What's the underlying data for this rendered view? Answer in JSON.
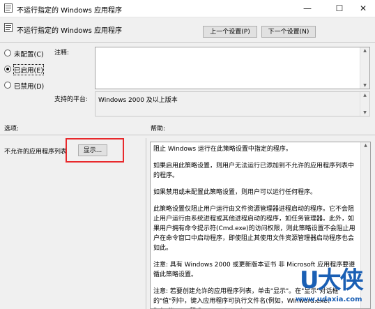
{
  "window": {
    "title": "不运行指定的 Windows 应用程序",
    "minimize": "—",
    "maximize": "☐",
    "close": "✕"
  },
  "header": {
    "title": "不运行指定的 Windows 应用程序",
    "prev_button": "上一个设置(P)",
    "next_button": "下一个设置(N)"
  },
  "state_options": {
    "not_configured": "未配置(C)",
    "enabled": "已启用(E)",
    "disabled": "已禁用(D)",
    "selected": "enabled"
  },
  "comment": {
    "label": "注释:",
    "value": ""
  },
  "platform": {
    "label": "支持的平台:",
    "value": "Windows 2000 及以上版本"
  },
  "options": {
    "label": "选项:",
    "list_label": "不允许的应用程序列表",
    "show_button": "显示..."
  },
  "help": {
    "label": "帮助:",
    "paragraphs": [
      "阻止 Windows 运行在此策略设置中指定的程序。",
      "如果启用此策略设置，则用户无法运行已添加到不允许的应用程序列表中的程序。",
      "如果禁用或未配置此策略设置，则用户可以运行任何程序。",
      "此策略设置仅阻止用户运行由文件资源管理器进程启动的程序。它不会阻止用户运行由系统进程或其他进程启动的程序，如任务管理器。此外，如果用户拥有命令提示符(Cmd.exe)的访问权限，则此策略设置不会阻止用户在命令窗口中启动程序，即使阻止其使用文件资源管理器启动程序也会如此。",
      "注意: 具有 Windows 2000 或更新版本证书 非 Microsoft 应用程序要遵循此策略设置。",
      "注意: 若要创建允许的应用程序列表，单击\"显示\"。在\"显示\"对话框的\"值\"列中，键入应用程序可执行文件名(例如，Winword.exe、Poledit.exe 和 Powerpnt.exe)。"
    ]
  },
  "watermark": {
    "logo": "U大侠",
    "url": "www.udaxia.com"
  },
  "colors": {
    "highlight_box": "#e8292c",
    "watermark_blue": "#1a5fb4"
  }
}
